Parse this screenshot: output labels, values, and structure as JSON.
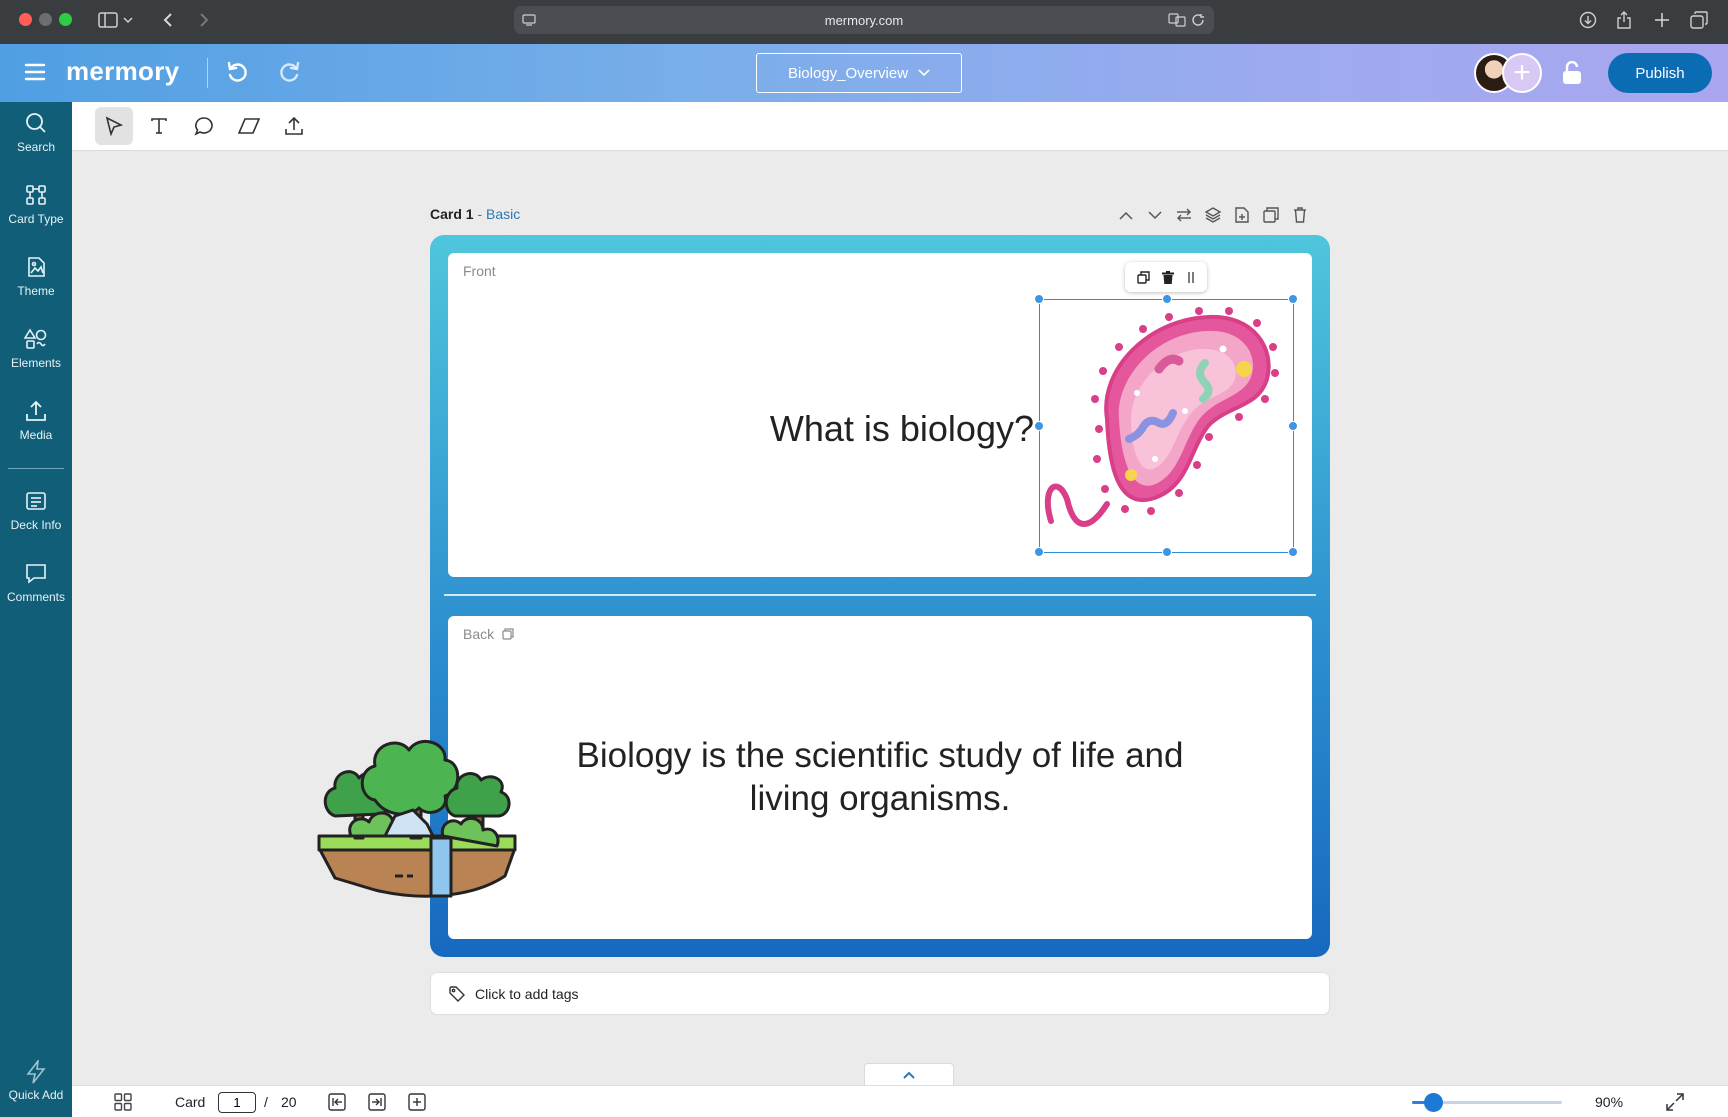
{
  "browser": {
    "url": "mermory.com"
  },
  "header": {
    "logo": "mermory",
    "deck_name": "Biology_Overview",
    "publish_label": "Publish"
  },
  "sidebar": {
    "items": [
      {
        "label": "Search",
        "icon": "search-icon"
      },
      {
        "label": "Card Type",
        "icon": "card-type-icon"
      },
      {
        "label": "Theme",
        "icon": "theme-icon"
      },
      {
        "label": "Elements",
        "icon": "elements-icon"
      },
      {
        "label": "Media",
        "icon": "media-icon"
      },
      {
        "label": "Deck Info",
        "icon": "deck-info-icon"
      },
      {
        "label": "Comments",
        "icon": "comments-icon"
      }
    ],
    "quick_add": "Quick Add"
  },
  "card": {
    "number_label": "Card 1",
    "separator": " - ",
    "type": "Basic",
    "front_label": "Front",
    "front_text": "What is biology?",
    "back_label": "Back",
    "back_text": "Biology is the scientific study of life and living organisms."
  },
  "tags": {
    "placeholder": "Click to add tags"
  },
  "bottom_bar": {
    "card_label": "Card",
    "current_page": "1",
    "separator": "/",
    "total_pages": "20",
    "zoom": "90%",
    "zoom_fraction": 0.14
  },
  "colors": {
    "sidebar": "#115e78",
    "publish": "#0b6cb4",
    "card_gradient_top": "#4ec6dc",
    "card_gradient_bottom": "#1769bf",
    "selection": "#2f8ae0"
  }
}
